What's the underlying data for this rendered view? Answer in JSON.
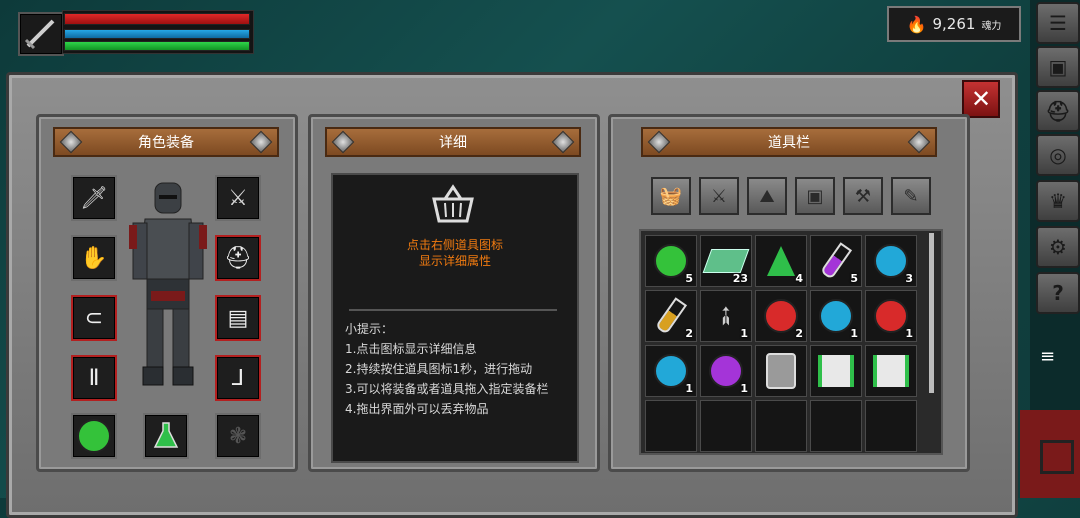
{
  "hud": {
    "souls_value": "9,261",
    "souls_unit": "魂力",
    "hp_fraction": 1.0,
    "mp_fraction": 1.0,
    "stamina_fraction": 1.0
  },
  "equipment": {
    "title": "角色装备"
  },
  "detail": {
    "title": "详细",
    "hint_line1": "点击右侧道具图标",
    "hint_line2": "显示详细属性",
    "tips_title": "小提示：",
    "tips": [
      "1.点击图标显示详细信息",
      "2.持续按住道具图标1秒，进行拖动",
      "3.可以将装备或者道具拖入指定装备栏",
      "4.拖出界面外可以丢弃物品"
    ]
  },
  "inventory": {
    "title": "道具栏",
    "items": [
      {
        "name": "green-potion",
        "count": "5",
        "color": "#34c23a"
      },
      {
        "name": "jade-ingot",
        "count": "23",
        "color": "#5fbf8a"
      },
      {
        "name": "green-flask",
        "count": "4",
        "color": "#2fbf4a"
      },
      {
        "name": "purple-vial",
        "count": "5",
        "color": "#a434d8"
      },
      {
        "name": "blue-potion",
        "count": "3",
        "color": "#22a8d8"
      },
      {
        "name": "yellow-vial",
        "count": "2",
        "color": "#d8a020"
      },
      {
        "name": "arrow",
        "count": "1",
        "color": "#cfcfcf"
      },
      {
        "name": "red-potion",
        "count": "2",
        "color": "#d82a2a"
      },
      {
        "name": "blue-potion",
        "count": "1",
        "color": "#22a8d8"
      },
      {
        "name": "red-potion",
        "count": "1",
        "color": "#d82a2a"
      },
      {
        "name": "blue-potion",
        "count": "1",
        "color": "#22a8d8"
      },
      {
        "name": "purple-potion",
        "count": "1",
        "color": "#a434d8"
      },
      {
        "name": "chest-armor",
        "count": "",
        "color": "#cfcfcf"
      },
      {
        "name": "green-pants",
        "count": "",
        "color": "#2fbf4a"
      },
      {
        "name": "green-pants",
        "count": "",
        "color": "#2fbf4a"
      }
    ]
  },
  "colors": {
    "accent_red": "#b32020",
    "title_wood": "#8a552a",
    "hint_orange": "#f07a10"
  }
}
